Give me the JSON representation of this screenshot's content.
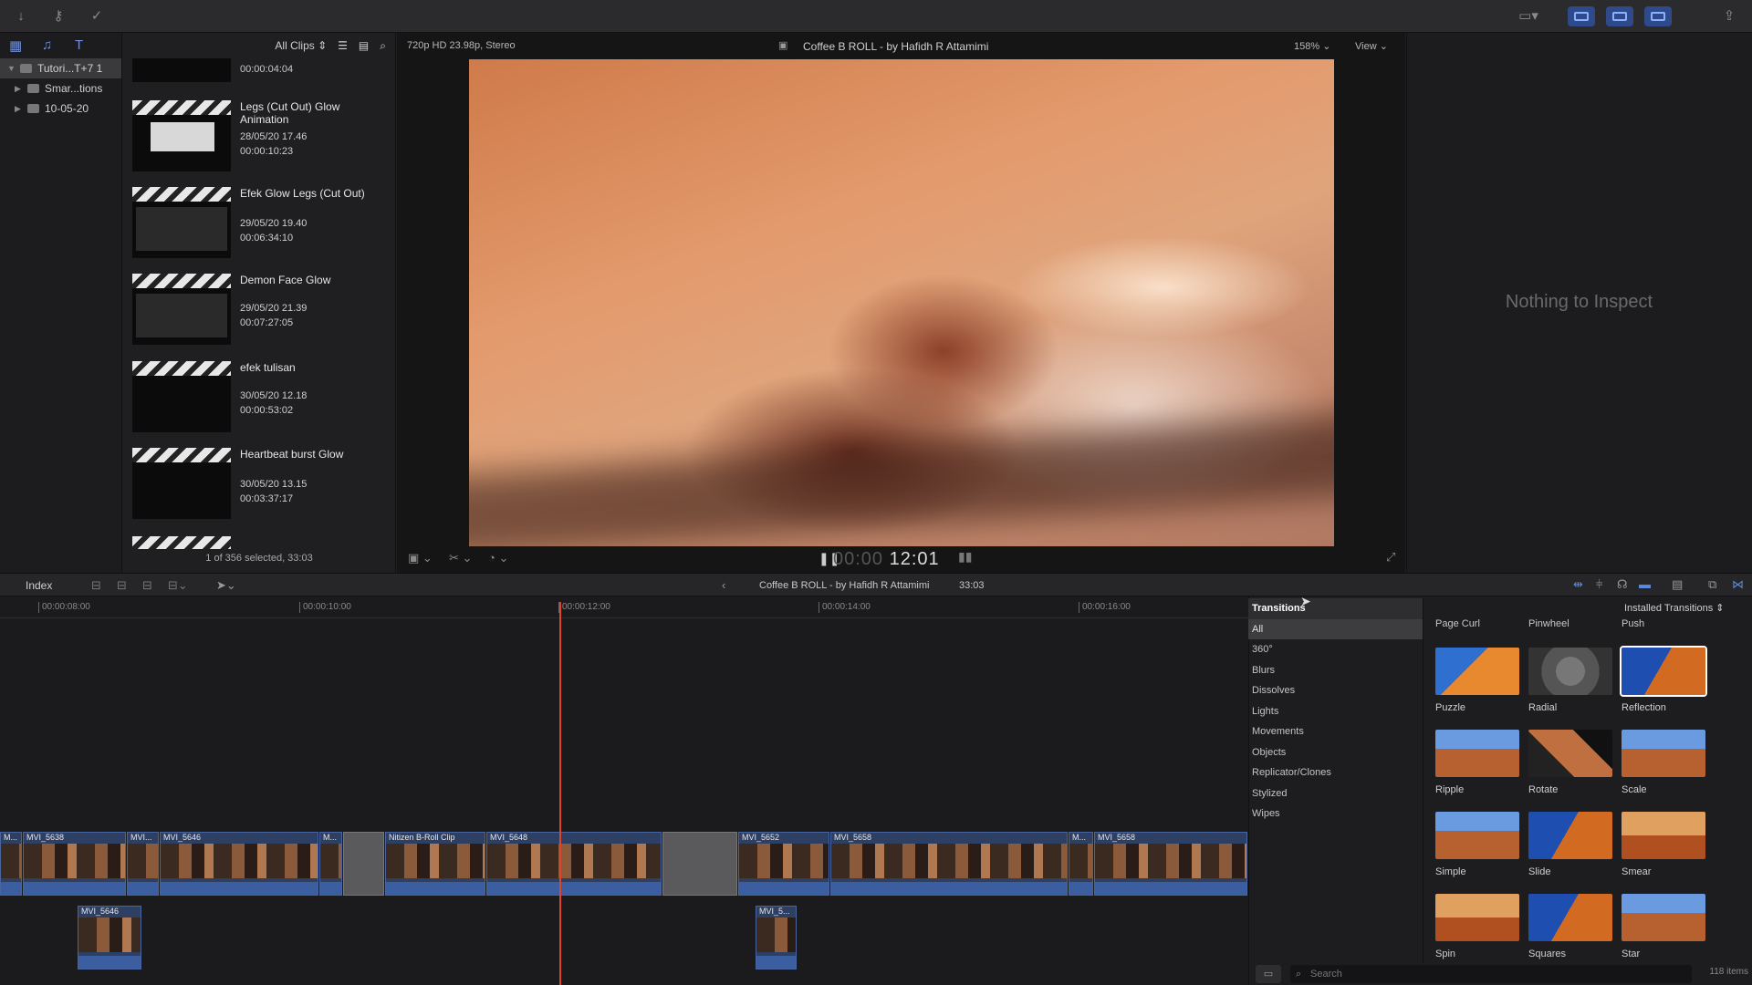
{
  "toolbar": {
    "icons": [
      "import-arrow-icon",
      "key-icon",
      "checkmark-circle-icon"
    ],
    "right_icons": [
      "workspace-icon",
      "browser-layout-icon",
      "timeline-layout-icon",
      "inspector-layout-icon",
      "share-icon"
    ]
  },
  "libraries": {
    "items": [
      {
        "label": "Tutori...T+7 1",
        "selected": true
      },
      {
        "label": "Smar...tions"
      },
      {
        "label": "10-05-20"
      }
    ]
  },
  "browser": {
    "filter": "All Clips",
    "first_duration": "00:00:04:04",
    "clips": [
      {
        "name": "Legs (Cut Out) Glow Animation",
        "date": "28/05/20 17.46",
        "duration": "00:00:10:23"
      },
      {
        "name": "Efek Glow Legs (Cut Out)",
        "date": "29/05/20 19.40",
        "duration": "00:06:34:10"
      },
      {
        "name": "Demon Face Glow",
        "date": "29/05/20 21.39",
        "duration": "00:07:27:05"
      },
      {
        "name": "efek tulisan",
        "date": "30/05/20 12.18",
        "duration": "00:00:53:02"
      },
      {
        "name": "Heartbeat burst Glow",
        "date": "30/05/20 13.15",
        "duration": "00:03:37:17"
      }
    ],
    "footer": "1 of 356 selected, 33:03"
  },
  "viewer": {
    "format": "720p HD 23.98p, Stereo",
    "title": "Coffee B ROLL - by Hafidh R Attamimi",
    "zoom": "158%",
    "view_label": "View",
    "timecode_dim": "00:00",
    "timecode": "12:01"
  },
  "inspector": {
    "empty_text": "Nothing to Inspect"
  },
  "timeline_bar": {
    "index_label": "Index",
    "project_title": "Coffee B ROLL - by Hafidh R Attamimi",
    "duration": "33:03"
  },
  "timeline": {
    "ruler": [
      "00:00:08:00",
      "00:00:10:00",
      "00:00:12:00",
      "00:00:14:00",
      "00:00:16:00"
    ],
    "clips": [
      "M...",
      "MVI_5638",
      "MVI...",
      "MVI_5646",
      "M...",
      "M...",
      "Nitizen B-Roll Clip",
      "MVI_5648",
      "MVI_5652",
      "MVI_5658",
      "M...",
      "MVI_5658"
    ],
    "connected": [
      "MVI_5646",
      "MVI_5..."
    ]
  },
  "transitions": {
    "header": "Transitions",
    "installed_label": "Installed Transitions",
    "categories": [
      "All",
      "360°",
      "Blurs",
      "Dissolves",
      "Lights",
      "Movements",
      "Objects",
      "Replicator/Clones",
      "Stylized",
      "Wipes"
    ],
    "top_captions": [
      "Page Curl",
      "Pinwheel",
      "Push"
    ],
    "tiles": [
      {
        "name": "Puzzle"
      },
      {
        "name": "Radial"
      },
      {
        "name": "Reflection"
      },
      {
        "name": "Ripple"
      },
      {
        "name": "Rotate"
      },
      {
        "name": "Scale"
      },
      {
        "name": "Simple"
      },
      {
        "name": "Slide"
      },
      {
        "name": "Smear"
      },
      {
        "name": "Spin"
      },
      {
        "name": "Squares"
      },
      {
        "name": "Star"
      }
    ],
    "search_placeholder": "Search",
    "items_count": "118 items"
  },
  "colors": {
    "accent": "#2f4a8a",
    "playhead": "#e0442a",
    "clip_blue": "#2d3f62"
  }
}
